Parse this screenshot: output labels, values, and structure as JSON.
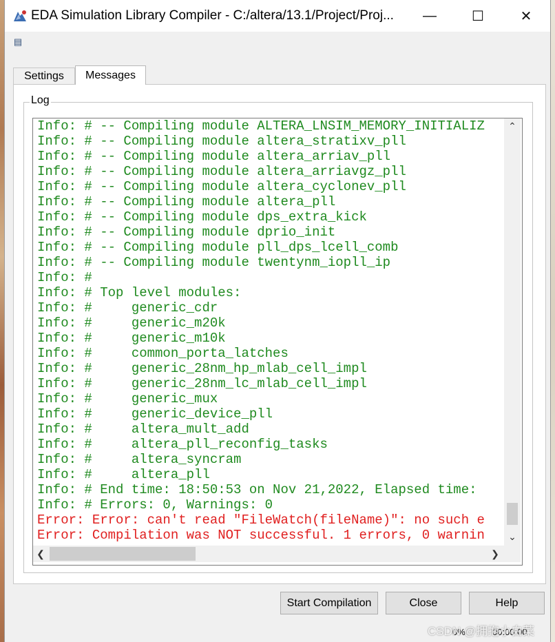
{
  "window": {
    "title": "EDA Simulation Library Compiler - C:/altera/13.1/Project/Proj...",
    "minimize_glyph": "—",
    "maximize_glyph": "☐",
    "close_glyph": "✕"
  },
  "tabs": [
    {
      "label": "Settings",
      "active": false
    },
    {
      "label": "Messages",
      "active": true
    }
  ],
  "log": {
    "group_label": "Log",
    "lines": [
      {
        "text": "Info: # -- Compiling module ALTERA_LNSIM_MEMORY_INITIALIZ",
        "type": "info"
      },
      {
        "text": "Info: # -- Compiling module altera_stratixv_pll",
        "type": "info"
      },
      {
        "text": "Info: # -- Compiling module altera_arriav_pll",
        "type": "info"
      },
      {
        "text": "Info: # -- Compiling module altera_arriavgz_pll",
        "type": "info"
      },
      {
        "text": "Info: # -- Compiling module altera_cyclonev_pll",
        "type": "info"
      },
      {
        "text": "Info: # -- Compiling module altera_pll",
        "type": "info"
      },
      {
        "text": "Info: # -- Compiling module dps_extra_kick",
        "type": "info"
      },
      {
        "text": "Info: # -- Compiling module dprio_init",
        "type": "info"
      },
      {
        "text": "Info: # -- Compiling module pll_dps_lcell_comb",
        "type": "info"
      },
      {
        "text": "Info: # -- Compiling module twentynm_iopll_ip",
        "type": "info"
      },
      {
        "text": "Info: #",
        "type": "info"
      },
      {
        "text": "Info: # Top level modules:",
        "type": "info"
      },
      {
        "text": "Info: #     generic_cdr",
        "type": "info"
      },
      {
        "text": "Info: #     generic_m20k",
        "type": "info"
      },
      {
        "text": "Info: #     generic_m10k",
        "type": "info"
      },
      {
        "text": "Info: #     common_porta_latches",
        "type": "info"
      },
      {
        "text": "Info: #     generic_28nm_hp_mlab_cell_impl",
        "type": "info"
      },
      {
        "text": "Info: #     generic_28nm_lc_mlab_cell_impl",
        "type": "info"
      },
      {
        "text": "Info: #     generic_mux",
        "type": "info"
      },
      {
        "text": "Info: #     generic_device_pll",
        "type": "info"
      },
      {
        "text": "Info: #     altera_mult_add",
        "type": "info"
      },
      {
        "text": "Info: #     altera_pll_reconfig_tasks",
        "type": "info"
      },
      {
        "text": "Info: #     altera_syncram",
        "type": "info"
      },
      {
        "text": "Info: #     altera_pll",
        "type": "info"
      },
      {
        "text": "Info: # End time: 18:50:53 on Nov 21,2022, Elapsed time:",
        "type": "info"
      },
      {
        "text": "Info: # Errors: 0, Warnings: 0",
        "type": "info"
      },
      {
        "text": "Error: Error: can't read \"FileWatch(fileName)\": no such e",
        "type": "error"
      },
      {
        "text": "Error: Compilation was NOT successful. 1 errors, 0 warnin",
        "type": "error"
      }
    ]
  },
  "buttons": {
    "start": "Start Compilation",
    "close": "Close",
    "help": "Help"
  },
  "status": {
    "progress": "0%",
    "elapsed": "00:00:00"
  },
  "watermark": "CSDN @拥抱小白菜",
  "icons": {
    "app": "eda-app-icon",
    "menu": "message-menu-icon"
  },
  "colors": {
    "info_text": "#1f8a1f",
    "error_text": "#e01f1f"
  }
}
